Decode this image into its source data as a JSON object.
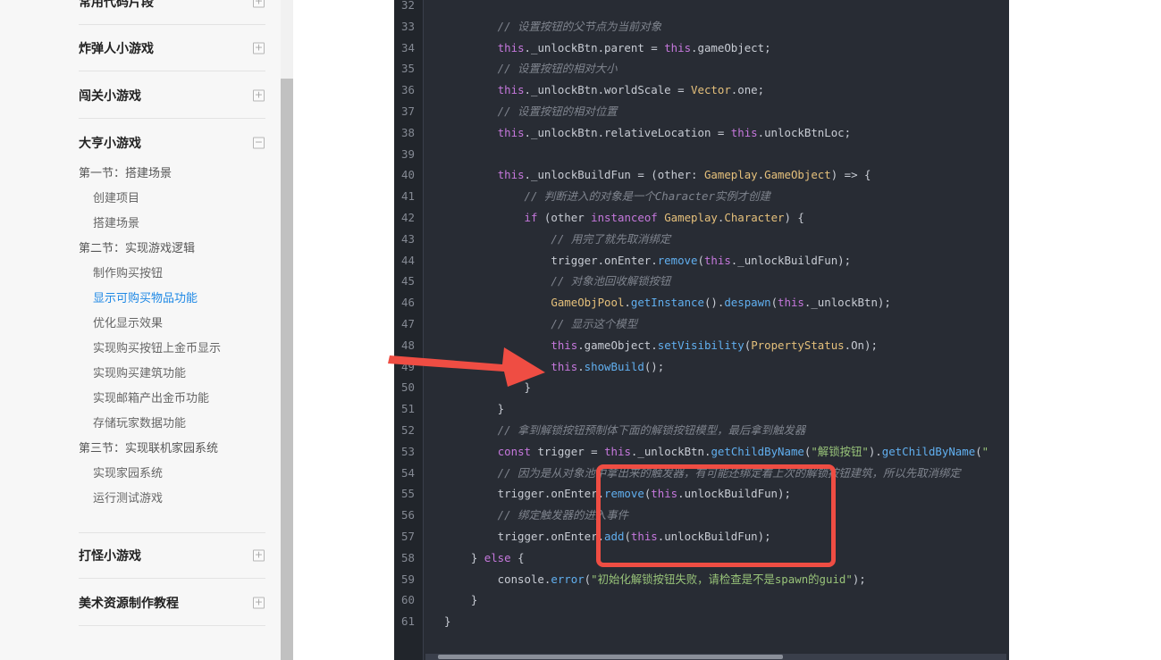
{
  "sidebar": {
    "sections": [
      {
        "title": "常用代码片段",
        "toggle": "+"
      },
      {
        "title": "炸弹人小游戏",
        "toggle": "+"
      },
      {
        "title": "闯关小游戏",
        "toggle": "+"
      },
      {
        "title": "大亨小游戏",
        "toggle": "−"
      },
      {
        "title": "打怪小游戏",
        "toggle": "+"
      },
      {
        "title": "美术资源制作教程",
        "toggle": "+"
      }
    ],
    "toc": [
      {
        "label": "第一节：搭建场景"
      },
      {
        "label": "创建项目"
      },
      {
        "label": "搭建场景"
      },
      {
        "label": "第二节：实现游戏逻辑"
      },
      {
        "label": "制作购买按钮"
      },
      {
        "label": "显示可购买物品功能"
      },
      {
        "label": "优化显示效果"
      },
      {
        "label": "实现购买按钮上金币显示"
      },
      {
        "label": "实现购买建筑功能"
      },
      {
        "label": "实现邮箱产出金币功能"
      },
      {
        "label": "存储玩家数据功能"
      },
      {
        "label": "第三节：实现联机家园系统"
      },
      {
        "label": "实现家园系统"
      },
      {
        "label": "运行测试游戏"
      }
    ]
  },
  "code": {
    "lines": [
      {
        "num": "32",
        "text": ""
      },
      {
        "num": "33",
        "text": "        // 设置按钮的父节点为当前对象"
      },
      {
        "num": "34",
        "text": "        this._unlockBtn.parent = this.gameObject;"
      },
      {
        "num": "35",
        "text": "        // 设置按钮的相对大小"
      },
      {
        "num": "36",
        "text": "        this._unlockBtn.worldScale = Vector.one;"
      },
      {
        "num": "37",
        "text": "        // 设置按钮的相对位置"
      },
      {
        "num": "38",
        "text": "        this._unlockBtn.relativeLocation = this.unlockBtnLoc;"
      },
      {
        "num": "39",
        "text": ""
      },
      {
        "num": "40",
        "text": "        this._unlockBuildFun = (other: Gameplay.GameObject) => {"
      },
      {
        "num": "41",
        "text": "            // 判断进入的对象是一个Character实例才创建"
      },
      {
        "num": "42",
        "text": "            if (other instanceof Gameplay.Character) {"
      },
      {
        "num": "43",
        "text": "                // 用完了就先取消绑定"
      },
      {
        "num": "44",
        "text": "                trigger.onEnter.remove(this._unlockBuildFun);"
      },
      {
        "num": "45",
        "text": "                // 对象池回收解锁按钮"
      },
      {
        "num": "46",
        "text": "                GameObjPool.getInstance().despawn(this._unlockBtn);"
      },
      {
        "num": "47",
        "text": "                // 显示这个模型"
      },
      {
        "num": "48",
        "text": "                this.gameObject.setVisibility(PropertyStatus.On);"
      },
      {
        "num": "49",
        "text": "                this.showBuild();"
      },
      {
        "num": "50",
        "text": "            }"
      },
      {
        "num": "51",
        "text": "        }"
      },
      {
        "num": "52",
        "text": "        // 拿到解锁按钮预制体下面的解锁按钮模型，最后拿到触发器"
      },
      {
        "num": "53",
        "text": "        const trigger = this._unlockBtn.getChildByName(\"解锁按钮\").getChildByName(\""
      },
      {
        "num": "54",
        "text": "        // 因为是从对象池中拿出来的触发器，有可能还绑定着上次的解锁按钮建筑，所以先取消绑定"
      },
      {
        "num": "55",
        "text": "        trigger.onEnter.remove(this.unlockBuildFun);"
      },
      {
        "num": "56",
        "text": "        // 绑定触发器的进入事件"
      },
      {
        "num": "57",
        "text": "        trigger.onEnter.add(this.unlockBuildFun);"
      },
      {
        "num": "58",
        "text": "    } else {"
      },
      {
        "num": "59",
        "text": "        console.error(\"初始化解锁按钮失败，请检查是不是spawn的guid\");"
      },
      {
        "num": "60",
        "text": "    }"
      },
      {
        "num": "61",
        "text": "}"
      }
    ]
  },
  "colors": {
    "code_bg": "#282c34",
    "gutter_bg": "#21252b",
    "highlight": "#ef4d43",
    "active_link": "#1e88e5"
  }
}
